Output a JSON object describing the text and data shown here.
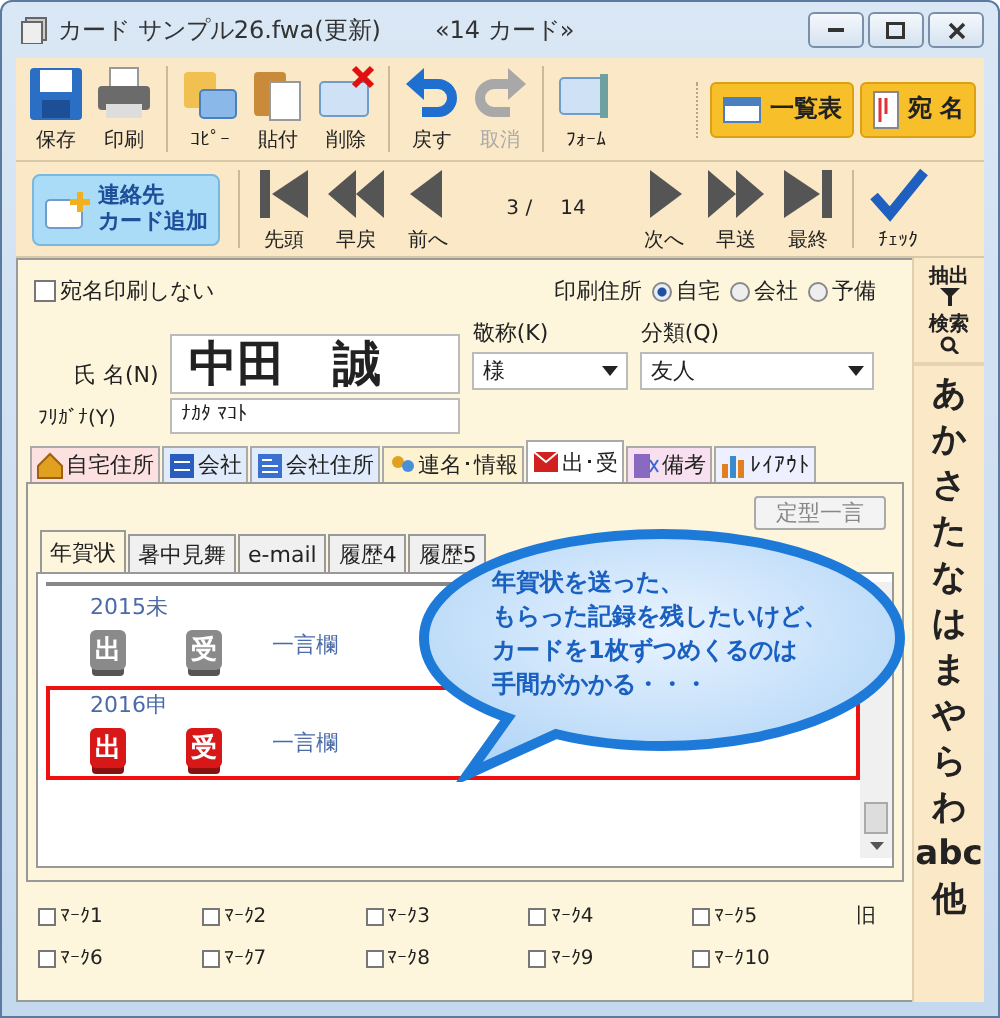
{
  "window": {
    "title": "カード サンプル26.fwa(更新)",
    "card_count": "«14 カード»"
  },
  "toolbar": [
    {
      "kind": "save",
      "label": "保存",
      "disabled": false
    },
    {
      "kind": "print",
      "label": "印刷",
      "disabled": false
    },
    {
      "kind": "copy",
      "label": "ｺﾋﾟｰ",
      "disabled": false
    },
    {
      "kind": "paste",
      "label": "貼付",
      "disabled": false
    },
    {
      "kind": "delete",
      "label": "削除",
      "disabled": false
    },
    {
      "kind": "undo",
      "label": "戻す",
      "disabled": false
    },
    {
      "kind": "redo",
      "label": "取消",
      "disabled": true
    },
    {
      "kind": "form",
      "label": "ﾌｫｰﾑ",
      "disabled": false
    }
  ],
  "view_buttons": [
    {
      "kind": "list",
      "label": "一覧表"
    },
    {
      "kind": "address",
      "label": "宛 名"
    }
  ],
  "add_card_button": {
    "lines": [
      "連絡先",
      "カード追加"
    ]
  },
  "navigation": [
    {
      "kind": "first",
      "label": "先頭"
    },
    {
      "kind": "rewind",
      "label": "早戻"
    },
    {
      "kind": "prev",
      "label": "前へ"
    },
    {
      "kind": "counter",
      "current": "3 /",
      "total": "14"
    },
    {
      "kind": "next",
      "label": "次へ"
    },
    {
      "kind": "forward",
      "label": "早送"
    },
    {
      "kind": "last",
      "label": "最終"
    },
    {
      "kind": "check",
      "label": "ﾁｪｯｸ"
    }
  ],
  "no_address_print": {
    "label": "宛名印刷しない",
    "checked": false
  },
  "print_address": {
    "label": "印刷住所",
    "options": [
      {
        "label": "自宅",
        "selected": true
      },
      {
        "label": "会社",
        "selected": false
      },
      {
        "label": "予備",
        "selected": false
      }
    ]
  },
  "name": {
    "label": "氏 名(N)",
    "value": "中田　誠"
  },
  "furigana": {
    "label": "ﾌﾘｶﾞﾅ(Y)",
    "value": "ﾅｶﾀ ﾏｺﾄ"
  },
  "honorific": {
    "label": "敬称(K)",
    "value": "様"
  },
  "category": {
    "label": "分類(Q)",
    "value": "友人"
  },
  "tabs": [
    {
      "kind": "home",
      "label": "自宅住所",
      "selected": false
    },
    {
      "kind": "company",
      "label": "会社",
      "selected": false
    },
    {
      "kind": "company_address",
      "label": "会社住所",
      "selected": false
    },
    {
      "kind": "joint",
      "label": "連名･情報",
      "selected": false
    },
    {
      "kind": "mail",
      "label": "出･受",
      "selected": true
    },
    {
      "kind": "memo",
      "label": "備考",
      "selected": false
    },
    {
      "kind": "layout",
      "label": "ﾚｲｱｳﾄ",
      "selected": false
    }
  ],
  "phrase_button": "定型一言",
  "greeting_tabs": [
    {
      "label": "年賀状",
      "selected": true
    },
    {
      "label": "暑中見舞",
      "selected": false
    },
    {
      "label": "e-mail",
      "selected": false
    },
    {
      "label": "履歴4",
      "selected": false
    },
    {
      "label": "履歴5",
      "selected": false
    }
  ],
  "records": [
    {
      "year": "2015未",
      "sent": {
        "label": "出",
        "active": false
      },
      "received": {
        "label": "受",
        "active": false
      },
      "note": "一言欄",
      "highlighted": false
    },
    {
      "year": "2016申",
      "sent": {
        "label": "出",
        "active": true
      },
      "received": {
        "label": "受",
        "active": true
      },
      "note": "一言欄",
      "highlighted": true
    }
  ],
  "callout": {
    "lines": [
      "年賀状を送った、",
      "もらった記録を残したいけど、",
      "カードを1枚ずつめくるのは",
      "手間がかかる・・・"
    ]
  },
  "marks": [
    {
      "label": "ﾏｰｸ1",
      "checked": false
    },
    {
      "label": "ﾏｰｸ2",
      "checked": false
    },
    {
      "label": "ﾏｰｸ3",
      "checked": false
    },
    {
      "label": "ﾏｰｸ4",
      "checked": false
    },
    {
      "label": "ﾏｰｸ5",
      "checked": false
    },
    {
      "label": "ﾏｰｸ6",
      "checked": false
    },
    {
      "label": "ﾏｰｸ7",
      "checked": false
    },
    {
      "label": "ﾏｰｸ8",
      "checked": false
    },
    {
      "label": "ﾏｰｸ9",
      "checked": false
    },
    {
      "label": "ﾏｰｸ10",
      "checked": false
    }
  ],
  "old_label": "旧",
  "side_tools": [
    {
      "kind": "filter",
      "label": "抽出"
    },
    {
      "kind": "search",
      "label": "検索"
    }
  ],
  "index": [
    "あ",
    "か",
    "さ",
    "た",
    "な",
    "は",
    "ま",
    "や",
    "ら",
    "わ",
    "abc",
    "他"
  ]
}
